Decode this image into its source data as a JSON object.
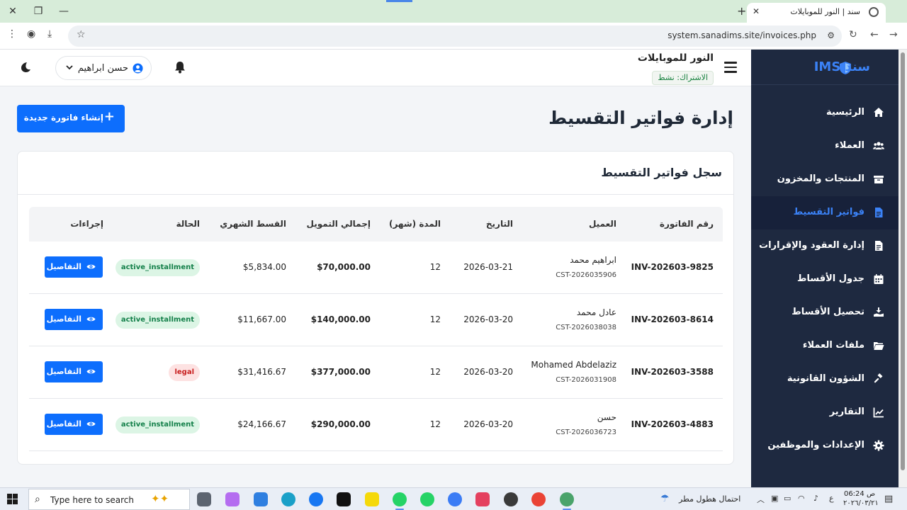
{
  "browser": {
    "tab_title": "سند | النور للموبايلات",
    "url": "system.sanadims.site/invoices.php"
  },
  "sidebar": {
    "brand": "سند IMS",
    "items": [
      {
        "label": "الرئيسية",
        "icon": "home-icon"
      },
      {
        "label": "العملاء",
        "icon": "users-icon"
      },
      {
        "label": "المنتجات والمخزون",
        "icon": "box-icon"
      },
      {
        "label": "فواتير التقسيط",
        "icon": "invoice-icon",
        "active": true
      },
      {
        "label": "إدارة العقود والإقرارات",
        "icon": "contract-icon"
      },
      {
        "label": "جدول الأقساط",
        "icon": "calendar-icon"
      },
      {
        "label": "تحصيل الأقساط",
        "icon": "collect-icon"
      },
      {
        "label": "ملفات العملاء",
        "icon": "folder-icon"
      },
      {
        "label": "الشؤون القانونية",
        "icon": "gavel-icon"
      },
      {
        "label": "التقارير",
        "icon": "chart-icon"
      },
      {
        "label": "الإعدادات والموظفين",
        "icon": "gear-icon"
      }
    ]
  },
  "header": {
    "store_name": "النور للموبايلات",
    "subscription": "الاشتراك: نشط",
    "user_name": "حسن ابراهيم"
  },
  "page": {
    "title": "إدارة فواتير التقسيط",
    "create_button": "إنشاء فاتورة جديدة",
    "card_title": "سجل فواتير التقسيط"
  },
  "table": {
    "headers": {
      "invoice": "رقم الفاتورة",
      "customer": "العميل",
      "date": "التاريخ",
      "duration": "المدة (شهر)",
      "total": "إجمالي التمويل",
      "monthly": "القسط الشهري",
      "status": "الحالة",
      "actions": "إجراءات"
    },
    "details_label": "التفاصيل",
    "rows": [
      {
        "invoice": "INV-202603-9825",
        "customer": "ابراهيم محمد",
        "customer_id": "CST-2026035906",
        "date": "2026-03-21",
        "duration": "12",
        "total": "$70,000.00",
        "monthly": "$5,834.00",
        "status": "active_installment",
        "status_color": "green"
      },
      {
        "invoice": "INV-202603-8614",
        "customer": "عادل محمد",
        "customer_id": "CST-2026038038",
        "date": "2026-03-20",
        "duration": "12",
        "total": "$140,000.00",
        "monthly": "$11,667.00",
        "status": "active_installment",
        "status_color": "green"
      },
      {
        "invoice": "INV-202603-3588",
        "customer": "Mohamed Abdelaziz",
        "customer_id": "CST-2026031908",
        "date": "2026-03-20",
        "duration": "12",
        "total": "$377,000.00",
        "monthly": "$31,416.67",
        "status": "legal",
        "status_color": "red"
      },
      {
        "invoice": "INV-202603-4883",
        "customer": "حسن",
        "customer_id": "CST-2026036723",
        "date": "2026-03-20",
        "duration": "12",
        "total": "$290,000.00",
        "monthly": "$24,166.67",
        "status": "active_installment",
        "status_color": "green"
      }
    ]
  },
  "taskbar": {
    "search_placeholder": "Type here to search",
    "weather": "احتمال هطول مطر",
    "time": "06:24 ص",
    "date": "٢٠٢٦/٠٣/٢١"
  }
}
